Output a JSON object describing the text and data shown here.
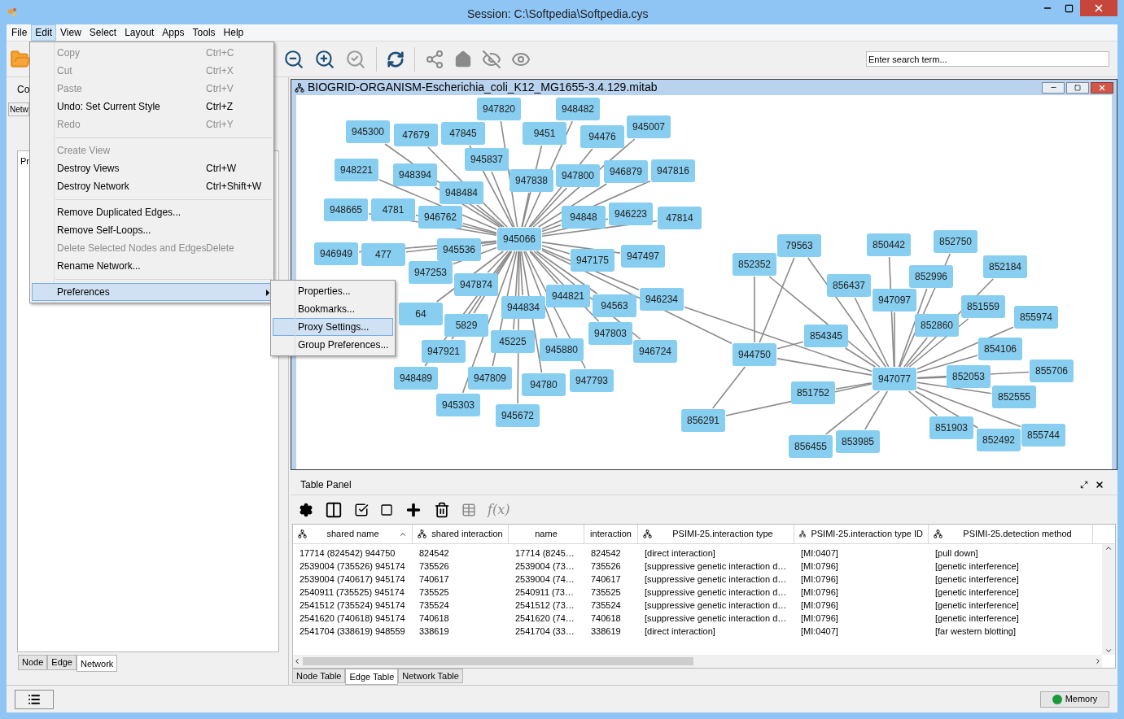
{
  "window": {
    "title": "Session: C:\\Softpedia\\Softpedia.cys"
  },
  "menubar": [
    {
      "label": "File",
      "selected": false
    },
    {
      "label": "Edit",
      "selected": true
    },
    {
      "label": "View",
      "selected": false
    },
    {
      "label": "Select",
      "selected": false
    },
    {
      "label": "Layout",
      "selected": false
    },
    {
      "label": "Apps",
      "selected": false
    },
    {
      "label": "Tools",
      "selected": false
    },
    {
      "label": "Help",
      "selected": false
    }
  ],
  "edit_menu": [
    {
      "kind": "item",
      "label": "Copy",
      "shortcut": "Ctrl+C",
      "disabled": true,
      "selected": false
    },
    {
      "kind": "item",
      "label": "Cut",
      "shortcut": "Ctrl+X",
      "disabled": true,
      "selected": false
    },
    {
      "kind": "item",
      "label": "Paste",
      "shortcut": "Ctrl+V",
      "disabled": true,
      "selected": false
    },
    {
      "kind": "item",
      "label": "Undo: Set Current Style",
      "shortcut": "Ctrl+Z",
      "disabled": false,
      "selected": false
    },
    {
      "kind": "item",
      "label": "Redo",
      "shortcut": "Ctrl+Y",
      "disabled": true,
      "selected": false
    },
    {
      "kind": "separator"
    },
    {
      "kind": "item",
      "label": "Create View",
      "disabled": true,
      "selected": false
    },
    {
      "kind": "item",
      "label": "Destroy Views",
      "shortcut": "Ctrl+W",
      "disabled": false,
      "selected": false
    },
    {
      "kind": "item",
      "label": "Destroy Network",
      "shortcut": "Ctrl+Shift+W",
      "disabled": false,
      "selected": false
    },
    {
      "kind": "separator"
    },
    {
      "kind": "item",
      "label": "Remove Duplicated Edges...",
      "disabled": false,
      "selected": false
    },
    {
      "kind": "item",
      "label": "Remove Self-Loops...",
      "disabled": false,
      "selected": false
    },
    {
      "kind": "item",
      "label": "Delete Selected Nodes and Edges",
      "shortcut": "Delete",
      "disabled": true,
      "selected": false
    },
    {
      "kind": "item",
      "label": "Rename Network...",
      "disabled": false,
      "selected": false
    },
    {
      "kind": "separator"
    },
    {
      "kind": "submenu",
      "label": "Preferences",
      "disabled": false,
      "selected": true
    }
  ],
  "preferences_submenu": [
    {
      "label": "Properties...",
      "selected": false
    },
    {
      "label": "Bookmarks...",
      "selected": false
    },
    {
      "label": "Proxy Settings...",
      "selected": true
    },
    {
      "label": "Group Preferences...",
      "selected": false
    }
  ],
  "search": {
    "placeholder": "Enter search term..."
  },
  "left_panel": {
    "header_fragment": "Co",
    "tab_fragment": "Netw",
    "section_fragment": "Pr",
    "tabs": [
      {
        "label": "Node",
        "selected": false
      },
      {
        "label": "Edge",
        "selected": false
      },
      {
        "label": "Network",
        "selected": true
      }
    ]
  },
  "network_view": {
    "title": "BIOGRID-ORGANISM-Escherichia_coli_K12_MG1655-3.4.129.mitab",
    "nodes": [
      {
        "label": "945300"
      },
      {
        "label": "47679"
      },
      {
        "label": "47845"
      },
      {
        "label": "947820"
      },
      {
        "label": "9451"
      },
      {
        "label": "948482"
      },
      {
        "label": "94476"
      },
      {
        "label": "945007"
      },
      {
        "label": "948221"
      },
      {
        "label": "948394"
      },
      {
        "label": "945837"
      },
      {
        "label": "947838"
      },
      {
        "label": "947800"
      },
      {
        "label": "946879"
      },
      {
        "label": "947816"
      },
      {
        "label": "948484"
      },
      {
        "label": "948665"
      },
      {
        "label": "4781"
      },
      {
        "label": "946762"
      },
      {
        "label": "94848"
      },
      {
        "label": "946223"
      },
      {
        "label": "47814"
      },
      {
        "label": "945066"
      },
      {
        "label": "946949"
      },
      {
        "label": "477"
      },
      {
        "label": "945536"
      },
      {
        "label": "947253"
      },
      {
        "label": "947175"
      },
      {
        "label": "947497"
      },
      {
        "label": "64"
      },
      {
        "label": "947874"
      },
      {
        "label": "5829"
      },
      {
        "label": "944834"
      },
      {
        "label": "944821"
      },
      {
        "label": "94563"
      },
      {
        "label": "946234"
      },
      {
        "label": "45225"
      },
      {
        "label": "947921"
      },
      {
        "label": "945880"
      },
      {
        "label": "947803"
      },
      {
        "label": "946724"
      },
      {
        "label": "948489"
      },
      {
        "label": "947809"
      },
      {
        "label": "94780"
      },
      {
        "label": "947793"
      },
      {
        "label": "945303"
      },
      {
        "label": "945672"
      },
      {
        "label": "79563"
      },
      {
        "label": "852352"
      },
      {
        "label": "850442"
      },
      {
        "label": "852750"
      },
      {
        "label": "852184"
      },
      {
        "label": "852996"
      },
      {
        "label": "856437"
      },
      {
        "label": "947097"
      },
      {
        "label": "851559"
      },
      {
        "label": "855974"
      },
      {
        "label": "852860"
      },
      {
        "label": "854345"
      },
      {
        "label": "854106"
      },
      {
        "label": "944750"
      },
      {
        "label": "947077"
      },
      {
        "label": "852053"
      },
      {
        "label": "855706"
      },
      {
        "label": "851752"
      },
      {
        "label": "852555"
      },
      {
        "label": "856291"
      },
      {
        "label": "851903"
      },
      {
        "label": "852492"
      },
      {
        "label": "855744"
      },
      {
        "label": "856455"
      },
      {
        "label": "853985"
      }
    ]
  },
  "table_panel": {
    "title": "Table Panel",
    "function_button": "f(x)",
    "columns": [
      {
        "label": "shared name",
        "kind": "shared",
        "sorted": true
      },
      {
        "label": "shared interaction",
        "kind": "shared",
        "sorted": false
      },
      {
        "label": "name",
        "kind": "local",
        "sorted": false
      },
      {
        "label": "interaction",
        "kind": "local",
        "sorted": false
      },
      {
        "label": "PSIMI-25.interaction type",
        "kind": "shared",
        "sorted": false
      },
      {
        "label": "PSIMI-25.interaction type ID",
        "kind": "shared",
        "sorted": false
      },
      {
        "label": "PSIMI-25.detection method",
        "kind": "shared",
        "sorted": false
      }
    ],
    "rows": [
      [
        "17714 (824542) 944750",
        "824542",
        "17714 (8245…",
        "824542",
        "[direct interaction]",
        "[MI:0407]",
        "[pull down]"
      ],
      [
        "2539004 (735526) 945174",
        "735526",
        "2539004 (73…",
        "735526",
        "[suppressive genetic interaction d…",
        "[MI:0796]",
        "[genetic interference]"
      ],
      [
        "2539004 (740617) 945174",
        "740617",
        "2539004 (74…",
        "740617",
        "[suppressive genetic interaction d…",
        "[MI:0796]",
        "[genetic interference]"
      ],
      [
        "2540911 (735525) 945174",
        "735525",
        "2540911 (73…",
        "735525",
        "[suppressive genetic interaction d…",
        "[MI:0796]",
        "[genetic interference]"
      ],
      [
        "2541512 (735524) 945174",
        "735524",
        "2541512 (73…",
        "735524",
        "[suppressive genetic interaction d…",
        "[MI:0796]",
        "[genetic interference]"
      ],
      [
        "2541620 (740618) 945174",
        "740618",
        "2541620 (74…",
        "740618",
        "[suppressive genetic interaction d…",
        "[MI:0796]",
        "[genetic interference]"
      ],
      [
        "2541704 (338619) 948559",
        "338619",
        "2541704 (33…",
        "338619",
        "[direct interaction]",
        "[MI:0407]",
        "[far western blotting]"
      ]
    ],
    "tabs": [
      {
        "label": "Node Table",
        "selected": false
      },
      {
        "label": "Edge Table",
        "selected": true
      },
      {
        "label": "Network Table",
        "selected": false
      }
    ]
  },
  "status_bar": {
    "memory_button": "Memory"
  }
}
